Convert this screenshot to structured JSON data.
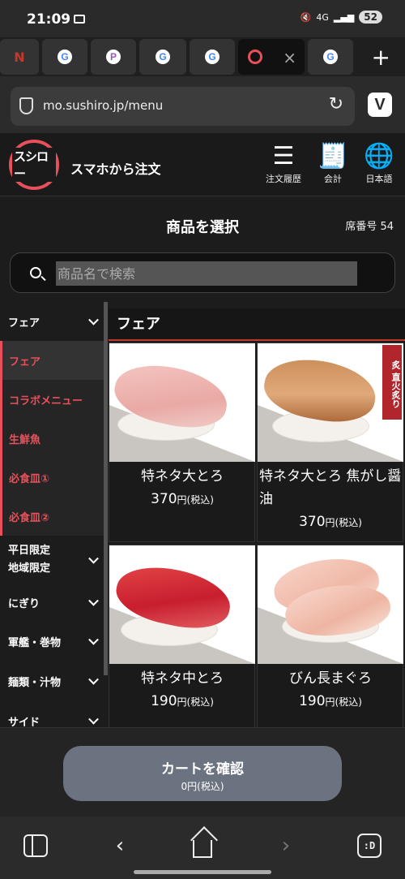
{
  "status_bar": {
    "time": "21:09",
    "network": "4G",
    "battery": "52"
  },
  "browser": {
    "tabs": [
      {
        "icon": "google-icon",
        "label": "G"
      },
      {
        "icon": "google-icon",
        "label": "G"
      },
      {
        "icon": "pokemon-icon",
        "label": "P"
      },
      {
        "icon": "google-icon",
        "label": "G"
      },
      {
        "icon": "google-icon",
        "label": "G"
      },
      {
        "icon": "sushiro-icon",
        "label": ""
      },
      {
        "icon": "google-icon",
        "label": "G"
      }
    ],
    "url": "mo.sushiro.jp/menu",
    "new_tab": "+",
    "close_tab": "×"
  },
  "header": {
    "logo_text": "スシロー",
    "title": "スマホから注文",
    "buttons": [
      {
        "label": "注文履歴",
        "icon": "list-icon"
      },
      {
        "label": "会計",
        "icon": "receipt-yen-icon"
      },
      {
        "label": "日本語",
        "icon": "globe-icon"
      }
    ]
  },
  "page": {
    "title": "商品を選択",
    "seat": "席番号 54"
  },
  "search": {
    "placeholder": "商品名で検索"
  },
  "categories": [
    {
      "label": "フェア",
      "type": "group"
    },
    {
      "label": "フェア",
      "type": "sub"
    },
    {
      "label": "コラボメニュー",
      "type": "sub"
    },
    {
      "label": "生鮮魚",
      "type": "sub"
    },
    {
      "label": "必食皿①",
      "type": "sub"
    },
    {
      "label": "必食皿②",
      "type": "sub"
    },
    {
      "label": "平日限定\n地域限定",
      "type": "group"
    },
    {
      "label": "にぎり",
      "type": "group"
    },
    {
      "label": "軍艦・巻物",
      "type": "group"
    },
    {
      "label": "麺類・汁物",
      "type": "group"
    },
    {
      "label": "サイド",
      "type": "group"
    }
  ],
  "section_title": "フェア",
  "products": [
    {
      "name": "特ネタ大とろ",
      "price": "370",
      "price_unit": "円(税込)"
    },
    {
      "name": "特ネタ大とろ 焦がし醤油",
      "price": "370",
      "price_unit": "円(税込)",
      "badge": "炙 直火炙り"
    },
    {
      "name": "特ネタ中とろ",
      "price": "190",
      "price_unit": "円(税込)"
    },
    {
      "name": "びん長まぐろ",
      "price": "190",
      "price_unit": "円(税込)"
    }
  ],
  "cart": {
    "label": "カートを確認",
    "total": "0円(税込)"
  },
  "colors": {
    "accent": "#e8505b",
    "cart_button": "#6b7280",
    "background": "#1c1c1c"
  }
}
